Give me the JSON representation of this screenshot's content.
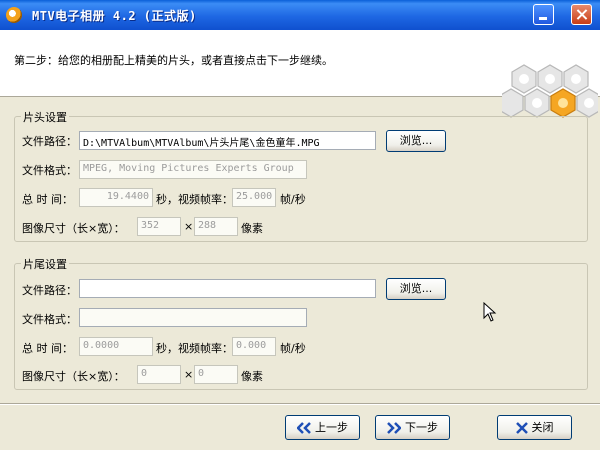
{
  "window": {
    "title": "MTV电子相册 4.2  (正式版)",
    "minimize_icon": "minimize-icon",
    "close_icon": "close-icon"
  },
  "header": {
    "step_text": "第二步：给您的相册配上精美的片头，或者直接点击下一步继续。",
    "logo_icon": "hexagon-cluster-icon"
  },
  "head_group": {
    "title": "片头设置",
    "path_label": "文件路径：",
    "path_value": "D:\\MTVAlbum\\MTVAlbum\\片头片尾\\金色童年.MPG",
    "browse_label": "浏览...",
    "format_label": "文件格式：",
    "format_value": "MPEG, Moving Pictures Experts Group",
    "duration_label": "总 时 间：",
    "duration_value": "19.4400",
    "seconds_label": "秒，视频帧率：",
    "fps_value": "25.000",
    "fps_unit": "帧/秒",
    "size_label": "图像尺寸（长×宽）：",
    "width_value": "352",
    "times": "×",
    "height_value": "288",
    "pixel_unit": "像素"
  },
  "tail_group": {
    "title": "片尾设置",
    "path_label": "文件路径：",
    "path_value": "",
    "browse_label": "浏览...",
    "format_label": "文件格式：",
    "format_value": "",
    "duration_label": "总 时 间：",
    "duration_value": "0.0000",
    "seconds_label": "秒，视频帧率：",
    "fps_value": "0.000",
    "fps_unit": "帧/秒",
    "size_label": "图像尺寸（长×宽）：",
    "width_value": "0",
    "times": "×",
    "height_value": "0",
    "pixel_unit": "像素"
  },
  "footer": {
    "prev_label": "上一步",
    "next_label": "下一步",
    "close_label": "关闭"
  },
  "colors": {
    "titlebar": "#1e67e3",
    "window_bg": "#ece9d8",
    "nav_icon": "#1f4fb6",
    "close_x": "#1f4fb6"
  }
}
